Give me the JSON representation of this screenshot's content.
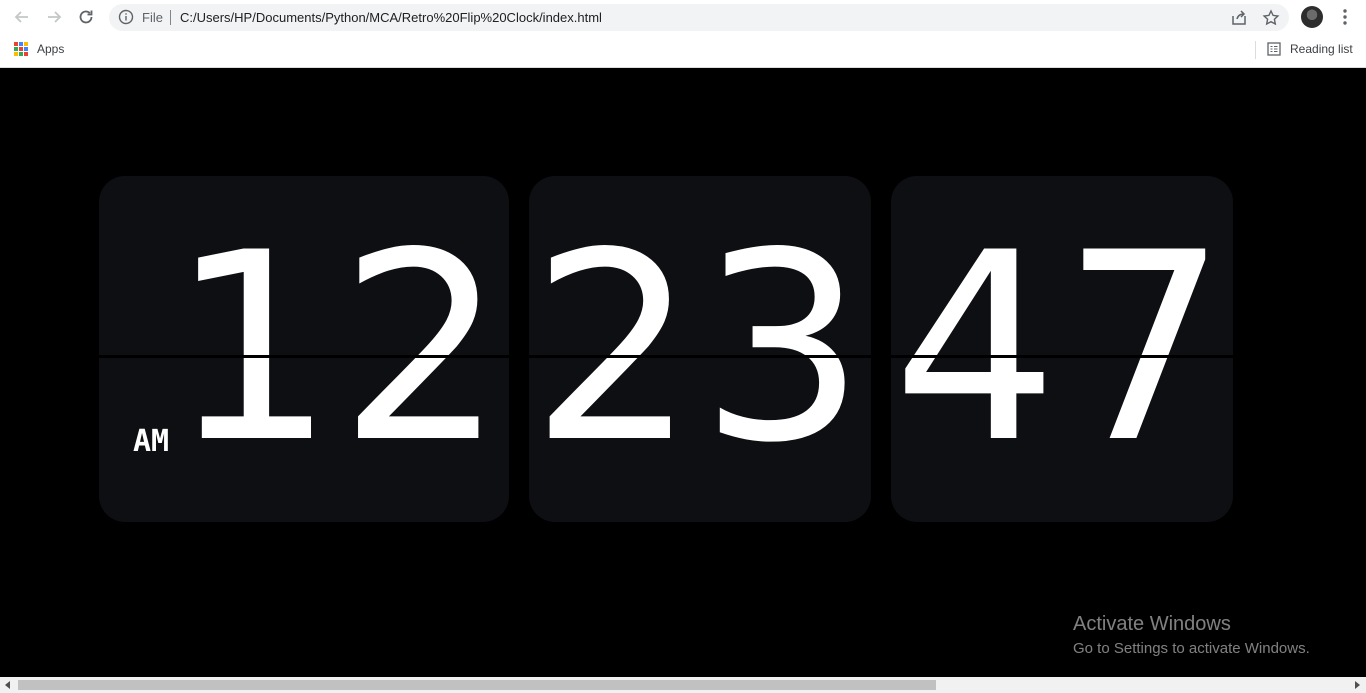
{
  "browser": {
    "omnibox": {
      "scheme_label": "File",
      "url": "C:/Users/HP/Documents/Python/MCA/Retro%20Flip%20Clock/index.html"
    },
    "icons": {
      "back": "back-arrow-icon",
      "forward": "forward-arrow-icon",
      "reload": "reload-icon",
      "info": "info-icon",
      "share": "share-icon",
      "bookmark": "star-icon",
      "menu": "more-vert-icon"
    },
    "bookmarks_bar": {
      "apps_label": "Apps",
      "reading_list_label": "Reading list"
    }
  },
  "clock": {
    "hours": "12",
    "minutes": "23",
    "seconds": "47",
    "period": "AM"
  },
  "watermark": {
    "title": "Activate Windows",
    "subtitle": "Go to Settings to activate Windows."
  },
  "colors": {
    "background": "#000000",
    "card": "#0d0f12",
    "digit": "#ffffff"
  }
}
